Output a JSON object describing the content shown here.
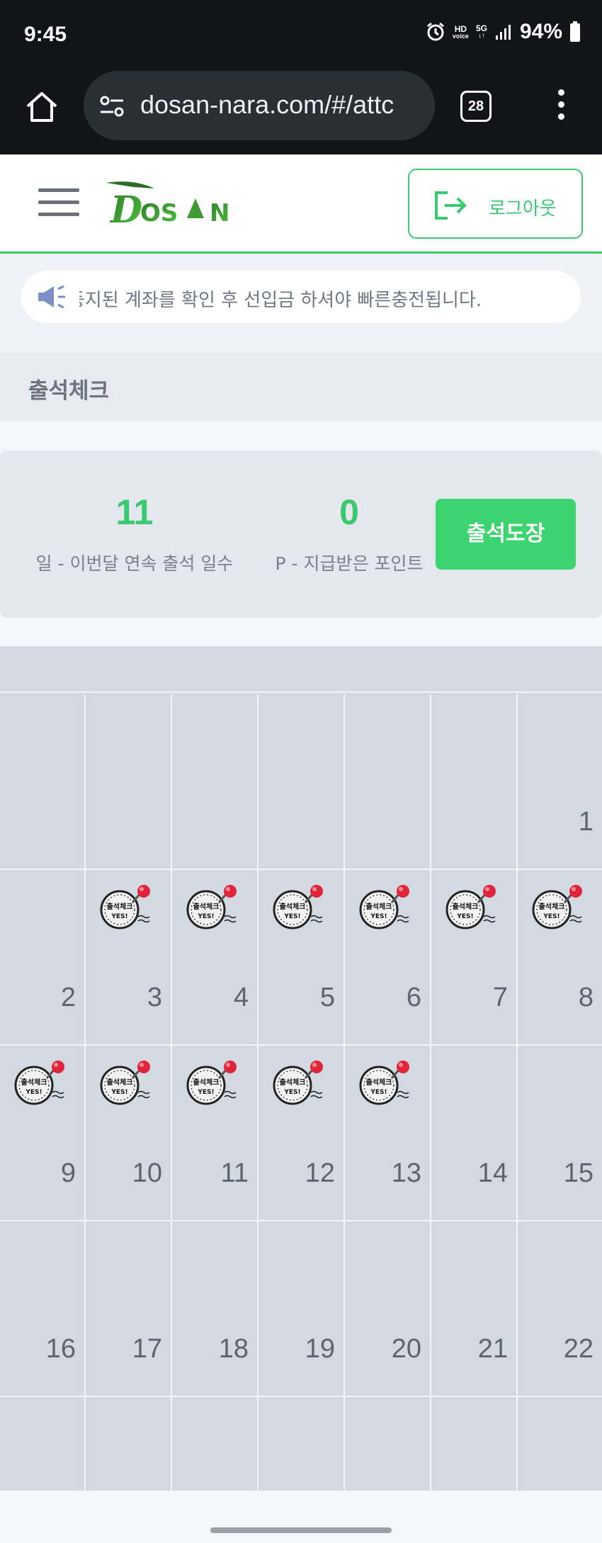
{
  "status_bar": {
    "time": "9:45",
    "network_hd": "HD",
    "network_voice": "voice",
    "network_5g": "5G",
    "battery": "94%"
  },
  "browser": {
    "url": "dosan-nara.com/#/attc",
    "tab_count": "28",
    "icons": [
      "home-icon",
      "site-settings-icon",
      "tabs-icon",
      "more-vert-icon"
    ]
  },
  "header": {
    "logo_text": "DOSAN",
    "logout_label": "로그아웃",
    "accent_color": "#3ac96e"
  },
  "notice": {
    "text": "등지된 계좌를 확인 후 선입금 하셔야 빠른충전됩니다."
  },
  "page": {
    "title": "출석체크"
  },
  "stats": {
    "days_value": "11",
    "days_label": "일 - 이번달 연속 출석 일수",
    "points_value": "0",
    "points_label": "P - 지급받은 포인트",
    "stamp_button": "출석도장"
  },
  "calendar": {
    "stamp_text": "출석체크",
    "stamp_sub": "YES!",
    "rows": [
      [
        {
          "day": "",
          "stamped": false
        },
        {
          "day": "",
          "stamped": false
        },
        {
          "day": "",
          "stamped": false
        },
        {
          "day": "",
          "stamped": false
        },
        {
          "day": "",
          "stamped": false
        },
        {
          "day": "",
          "stamped": false
        },
        {
          "day": "1",
          "stamped": false
        }
      ],
      [
        {
          "day": "2",
          "stamped": false
        },
        {
          "day": "3",
          "stamped": true
        },
        {
          "day": "4",
          "stamped": true
        },
        {
          "day": "5",
          "stamped": true
        },
        {
          "day": "6",
          "stamped": true
        },
        {
          "day": "7",
          "stamped": true
        },
        {
          "day": "8",
          "stamped": true
        }
      ],
      [
        {
          "day": "9",
          "stamped": true
        },
        {
          "day": "10",
          "stamped": true
        },
        {
          "day": "11",
          "stamped": true
        },
        {
          "day": "12",
          "stamped": true
        },
        {
          "day": "13",
          "stamped": true
        },
        {
          "day": "14",
          "stamped": false
        },
        {
          "day": "15",
          "stamped": false
        }
      ],
      [
        {
          "day": "16",
          "stamped": false
        },
        {
          "day": "17",
          "stamped": false
        },
        {
          "day": "18",
          "stamped": false
        },
        {
          "day": "19",
          "stamped": false
        },
        {
          "day": "20",
          "stamped": false
        },
        {
          "day": "21",
          "stamped": false
        },
        {
          "day": "22",
          "stamped": false
        }
      ],
      [
        {
          "day": "",
          "stamped": false
        },
        {
          "day": "",
          "stamped": false
        },
        {
          "day": "",
          "stamped": false
        },
        {
          "day": "",
          "stamped": false
        },
        {
          "day": "",
          "stamped": false
        },
        {
          "day": "",
          "stamped": false
        },
        {
          "day": "",
          "stamped": false
        }
      ]
    ]
  }
}
